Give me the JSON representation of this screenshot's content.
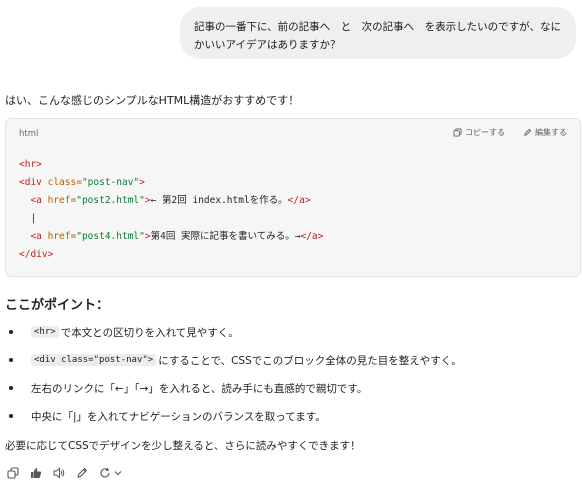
{
  "user_message": {
    "line1": "記事の一番下に、前の記事へ　と　次の記事へ　を表示したいのですが、なに",
    "line2": "かいいアイデアはありますか？"
  },
  "assistant": {
    "intro": "はい、こんな感じのシンプルなHTML構造がおすすめです！",
    "code_block": {
      "language": "html",
      "copy_label": "コピーする",
      "edit_label": "編集する",
      "lines": {
        "l1_tag": "<hr>",
        "l2_open": "<div ",
        "l2_attr": "class=",
        "l2_str": "\"post-nav\"",
        "l2_close": ">",
        "l3_open": "  <a ",
        "l3_attr": "href=",
        "l3_str": "\"post2.html\"",
        "l3_gt": ">",
        "l3_text": "← 第2回 index.htmlを作る。",
        "l3_end": "</a>",
        "l4_text": "  |",
        "l5_open": "  <a ",
        "l5_attr": "href=",
        "l5_str": "\"post4.html\"",
        "l5_gt": ">",
        "l5_text": "第4回 実際に記事を書いてみる。→",
        "l5_end": "</a>",
        "l6_tag": "</div>"
      }
    },
    "points_heading": "ここがポイント：",
    "points": [
      {
        "code": "<hr>",
        "text": "で本文との区切りを入れて見やすく。"
      },
      {
        "code": "<div class=\"post-nav\">",
        "text": "にすることで、CSSでこのブロック全体の見た目を整えやすく。"
      },
      {
        "code": "",
        "text": "左右のリンクに「←」「→」を入れると、読み手にも直感的で親切です。"
      },
      {
        "code": "",
        "text": "中央に「|」を入れてナビゲーションのバランスを取ってます。"
      }
    ],
    "closing": "必要に応じてCSSでデザインを少し整えると、さらに読みやすくできます！"
  },
  "actions": {
    "icons": [
      "copy-icon",
      "thumbs-up-icon",
      "speaker-icon",
      "edit-icon",
      "regenerate-icon",
      "chevron-down-icon"
    ]
  },
  "colors": {
    "bubble": "#efefef",
    "code_bg": "#f6f6f6",
    "tag": "#b3261e",
    "attr": "#b45f06",
    "string": "#0b7a3a"
  }
}
